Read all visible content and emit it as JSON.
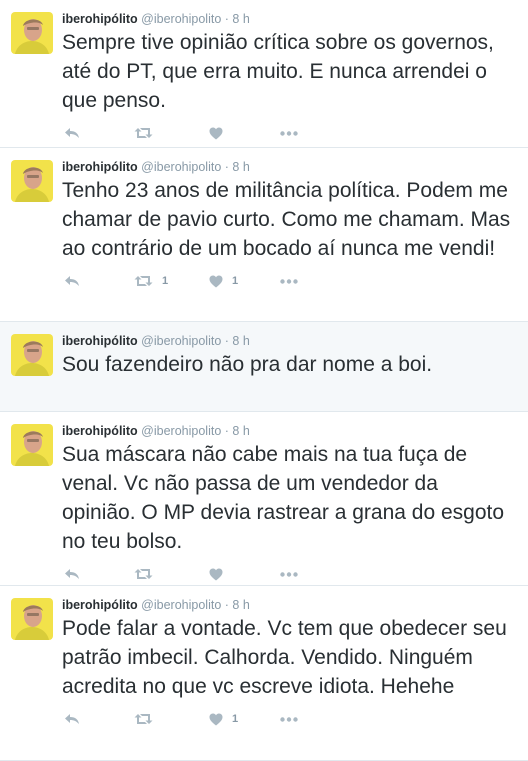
{
  "colors": {
    "text": "#292f33",
    "muted": "#8899a6",
    "icon": "#aab8c2",
    "highlight_bg": "#f5f8fa",
    "avatar_bg": "#f2e24a"
  },
  "tweets": [
    {
      "fullname": "iberohipólito",
      "handle": "@iberohipolito",
      "dot": "·",
      "time": "8 h",
      "text": "Sempre tive opinião crítica sobre os governos, até do PT, que erra muito.  E nunca arrendei o que penso.",
      "retweets": "",
      "likes": ""
    },
    {
      "fullname": "iberohipólito",
      "handle": "@iberohipolito",
      "dot": "·",
      "time": "8 h",
      "text": "Tenho 23 anos de militância política. Podem me chamar de pavio curto. Como me chamam. Mas ao contrário de um bocado aí nunca me vendi!",
      "retweets": "1",
      "likes": "1"
    },
    {
      "fullname": "iberohipólito",
      "handle": "@iberohipolito",
      "dot": "·",
      "time": "8 h",
      "text": "Sou fazendeiro não pra dar nome a boi.",
      "retweets": "",
      "likes": ""
    },
    {
      "fullname": "iberohipólito",
      "handle": "@iberohipolito",
      "dot": "·",
      "time": "8 h",
      "text": "Sua máscara não cabe mais na tua fuça de venal. Vc não passa de um vendedor da opinião. O MP devia rastrear a grana do esgoto no teu bolso.",
      "retweets": "",
      "likes": ""
    },
    {
      "fullname": "iberohipólito",
      "handle": "@iberohipolito",
      "dot": "·",
      "time": "8 h",
      "text": "Pode falar a vontade. Vc tem que obedecer seu patrão imbecil. Calhorda. Vendido. Ninguém acredita no que vc escreve idiota. Hehehe",
      "retweets": "",
      "likes": "1"
    }
  ],
  "icons": {
    "avatar": "user-photo",
    "reply": "reply-arrow-icon",
    "retweet": "retweet-icon",
    "like": "heart-icon",
    "more": "ellipsis-icon"
  }
}
